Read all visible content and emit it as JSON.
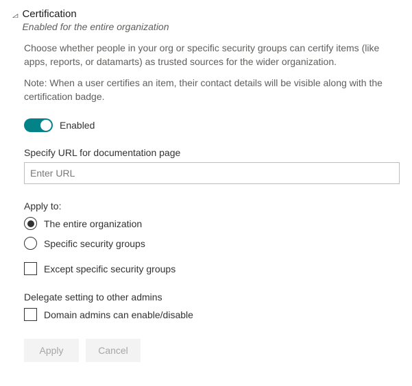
{
  "header": {
    "title": "Certification",
    "subtitle": "Enabled for the entire organization"
  },
  "description": "Choose whether people in your org or specific security groups can certify items (like apps, reports, or datamarts) as trusted sources for the wider organization.",
  "note": "Note: When a user certifies an item, their contact details will be visible along with the certification badge.",
  "toggle": {
    "state_label": "Enabled"
  },
  "url_field": {
    "label": "Specify URL for documentation page",
    "placeholder": "Enter URL",
    "value": ""
  },
  "apply_to": {
    "label": "Apply to:",
    "options": {
      "entire_org": "The entire organization",
      "specific_groups": "Specific security groups"
    },
    "except_label": "Except specific security groups"
  },
  "delegate": {
    "label": "Delegate setting to other admins",
    "option": "Domain admins can enable/disable"
  },
  "buttons": {
    "apply": "Apply",
    "cancel": "Cancel"
  }
}
